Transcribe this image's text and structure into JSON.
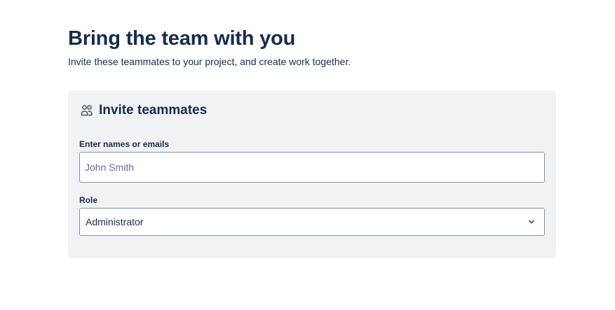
{
  "header": {
    "title": "Bring the team with you",
    "subtitle": "Invite these teammates to your project, and create work together."
  },
  "invite_card": {
    "title": "Invite teammates",
    "icon": "people-icon",
    "names_field": {
      "label": "Enter names or emails",
      "value": "",
      "placeholder": "John Smith"
    },
    "role_field": {
      "label": "Role",
      "selected": "Administrator",
      "icon": "chevron-down-icon"
    }
  },
  "colors": {
    "text": "#172b4d",
    "card_background": "#f1f2f4",
    "input_border": "#8590a2",
    "placeholder": "#626f86"
  }
}
